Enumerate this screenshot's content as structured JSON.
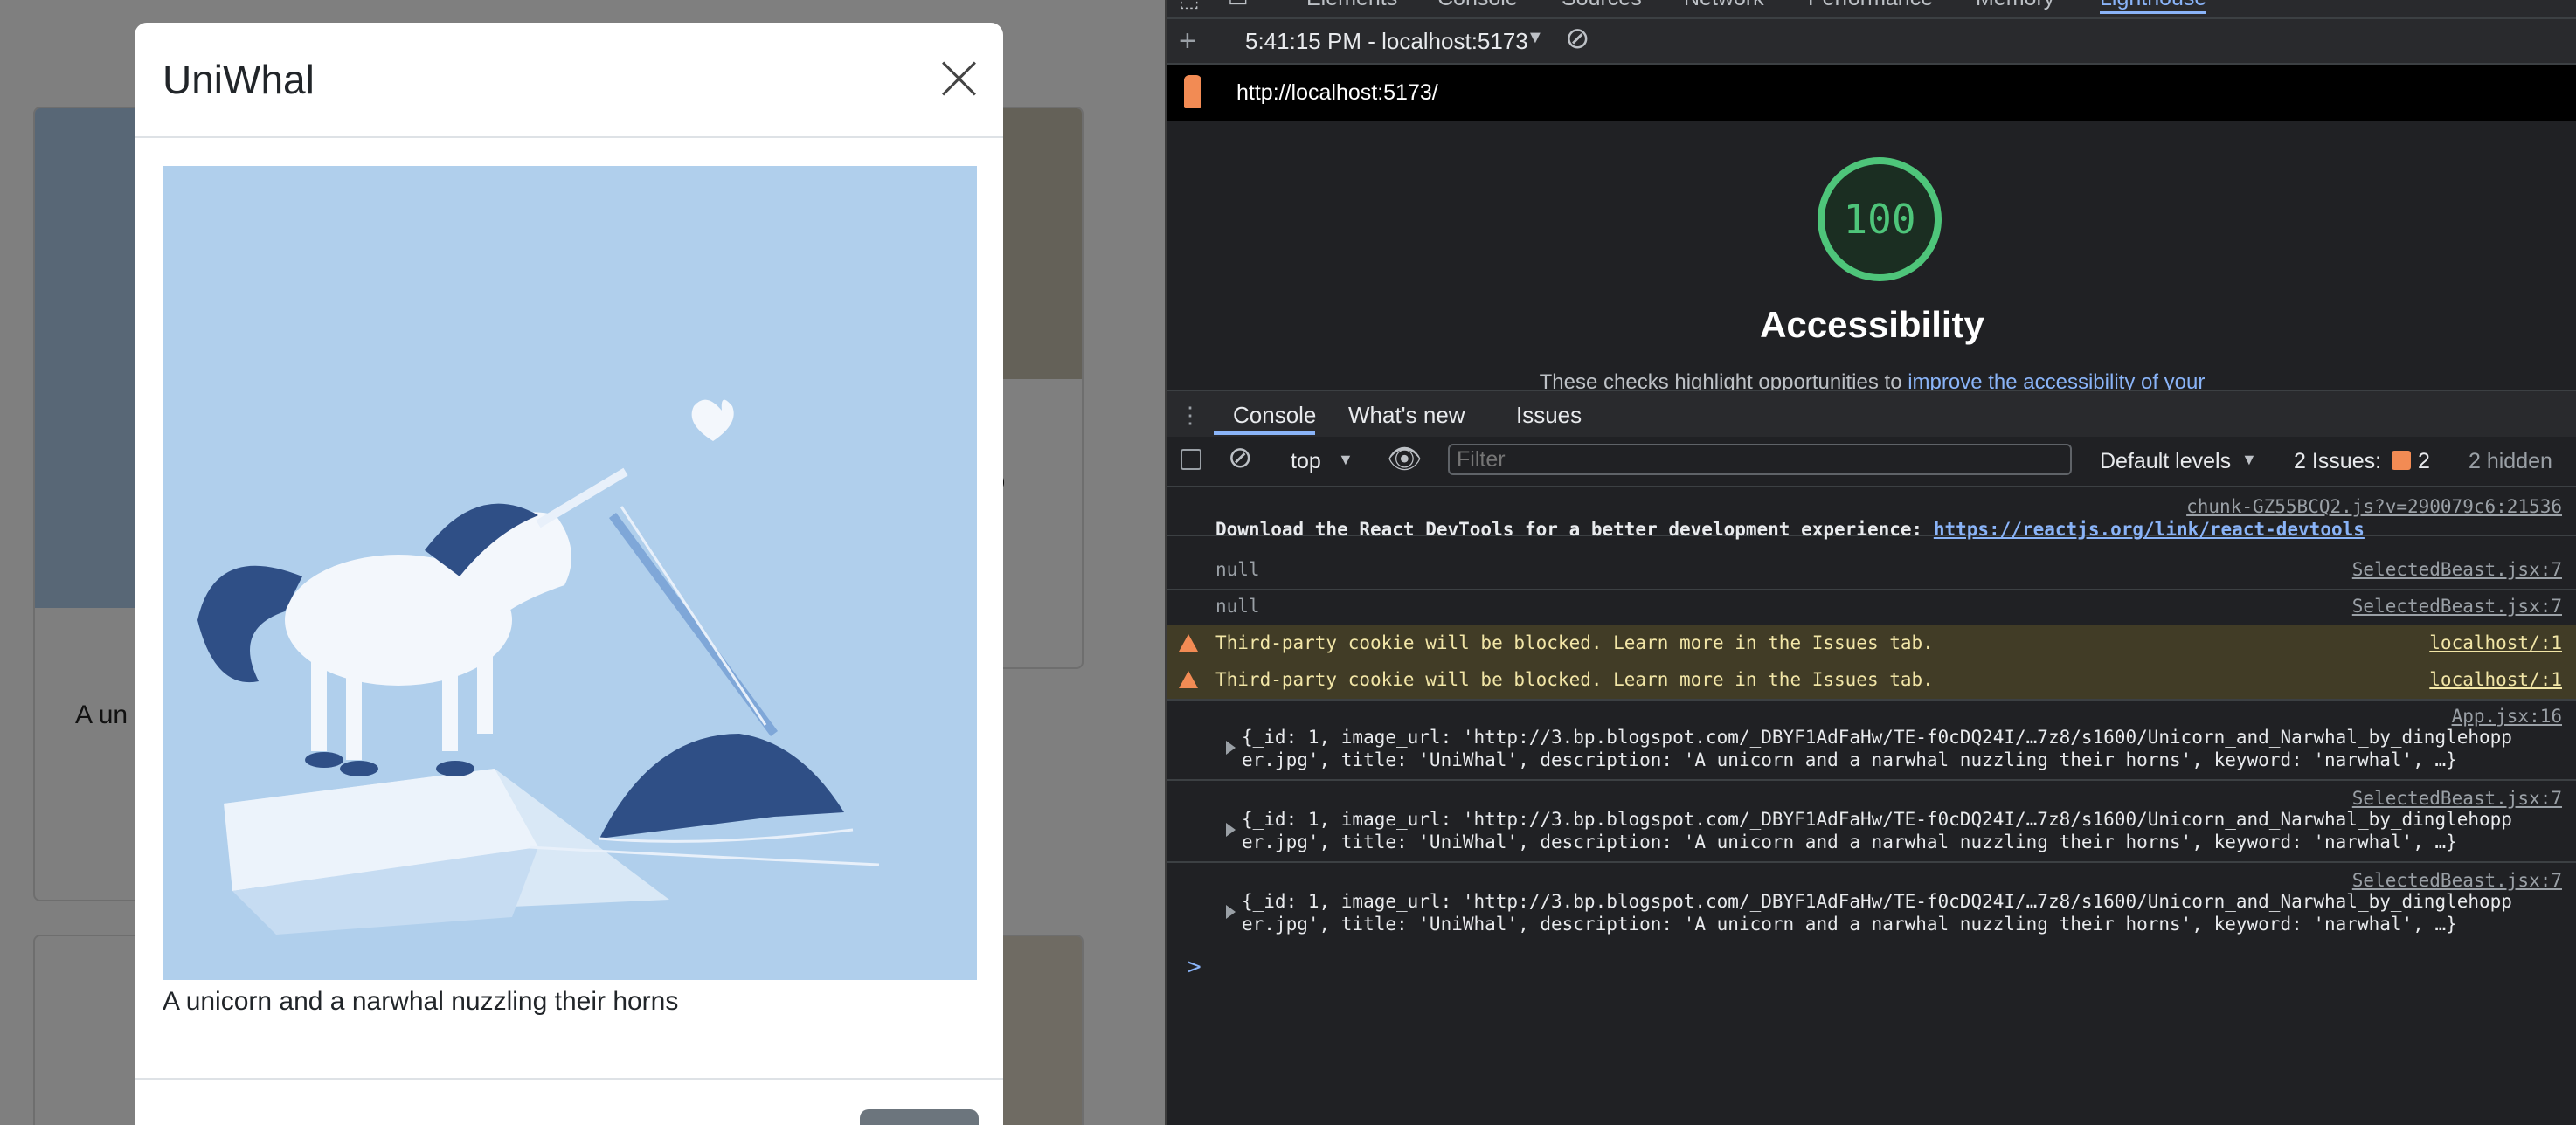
{
  "app": {
    "background_card_text": "A un",
    "background_card_text_right": "wo"
  },
  "modal": {
    "title": "UniWhal",
    "description": "A unicorn and a narwhal nuzzling their horns",
    "close_icon": "close-icon"
  },
  "devtools": {
    "top_tabs": [
      "Elements",
      "Console",
      "Sources",
      "Network",
      "Performance",
      "Memory",
      "Lighthouse"
    ],
    "lighthouse": {
      "toolbar_time": "5:41:15 PM - localhost:5173",
      "url": "http://localhost:5173/",
      "score": "100",
      "category": "Accessibility",
      "subtitle_prefix": "These checks highlight opportunities to ",
      "subtitle_link": "improve the accessibility of your"
    },
    "drawer_tabs": [
      "Console",
      "What's new",
      "Issues"
    ],
    "console_toolbar": {
      "context": "top",
      "filter_placeholder": "Filter",
      "levels": "Default levels",
      "issues_label": "2 Issues:",
      "issues_count": "2",
      "hidden": "2 hidden"
    },
    "messages": {
      "m1_source": "chunk-GZ55BCQ2.js?v=290079c6:21536",
      "m1_text": "Download the React DevTools for a better development experience: ",
      "m1_link": "https://reactjs.org/link/react-devtools",
      "m2_text": "null",
      "m2_source": "SelectedBeast.jsx:7",
      "m3_text": "null",
      "m3_source": "SelectedBeast.jsx:7",
      "w1_text": "Third-party cookie will be blocked. Learn more in the Issues tab.",
      "w1_source": "localhost/:1",
      "w2_text": "Third-party cookie will be blocked. Learn more in the Issues tab.",
      "w2_source": "localhost/:1",
      "o1_source": "App.jsx:16",
      "o2_source": "SelectedBeast.jsx:7",
      "o3_source": "SelectedBeast.jsx:7",
      "obj_line1": "{_id: 1, image_url: 'http://3.bp.blogspot.com/_DBYF1AdFaHw/TE-f0cDQ24I/…7z8/s1600/Unicorn_and_Narwhal_by_dinglehopp",
      "obj_line2": "er.jpg', title: 'UniWhal', description: 'A unicorn and a narwhal nuzzling their horns', keyword: 'narwhal', …}"
    },
    "prompt": ">"
  },
  "colors": {
    "score_green": "#4ec57a",
    "link_blue": "#8ab4f8",
    "warning_bg": "#413c26",
    "warning_icon": "#f28b54",
    "modal_image_bg": "#b0cfec"
  }
}
